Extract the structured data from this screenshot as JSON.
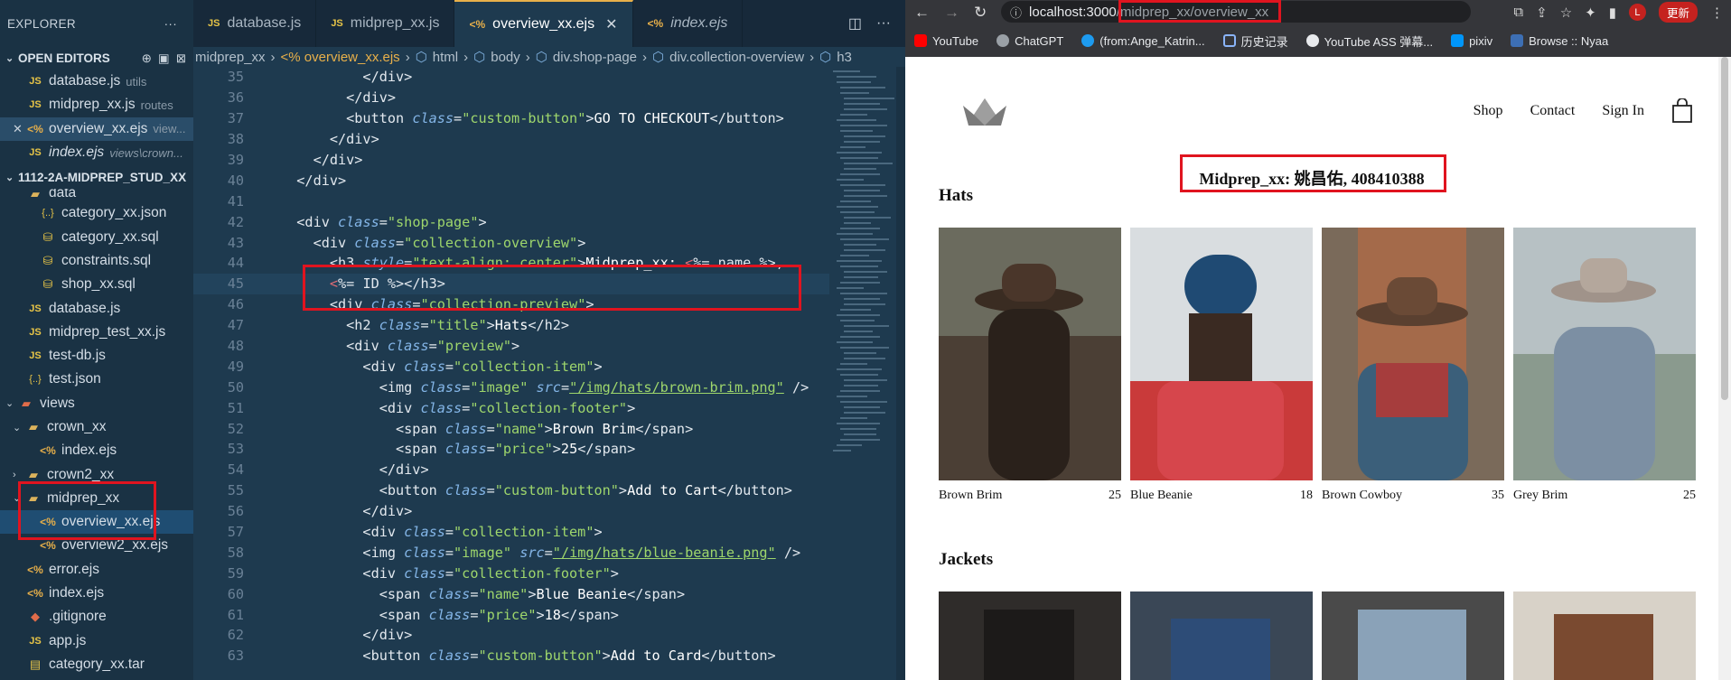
{
  "explorer": {
    "title": "EXPLORER",
    "open_editors_label": "OPEN EDITORS",
    "open_editors": [
      {
        "name": "database.js",
        "dir": "utils"
      },
      {
        "name": "midprep_xx.js",
        "dir": "routes"
      },
      {
        "name": "overview_xx.ejs",
        "dir": "view..."
      },
      {
        "name": "index.ejs",
        "dir": "views\\crown..."
      }
    ],
    "project_label": "1112-2A-MIDPREP_STUD_XX",
    "tree": [
      "data",
      "category_xx.json",
      "category_xx.sql",
      "constraints.sql",
      "shop_xx.sql",
      "database.js",
      "midprep_test_xx.js",
      "test-db.js",
      "test.json",
      "views",
      "crown_xx",
      "index.ejs",
      "crown2_xx",
      "midprep_xx",
      "overview_xx.ejs",
      "overview2_xx.ejs",
      "error.ejs",
      "index.ejs",
      ".gitignore",
      "app.js",
      "category_xx.tar"
    ]
  },
  "tabs": [
    {
      "label": "database.js"
    },
    {
      "label": "midprep_xx.js"
    },
    {
      "label": "overview_xx.ejs"
    },
    {
      "label": "index.ejs"
    }
  ],
  "breadcrumb": [
    "midprep_xx",
    "<% overview_xx.ejs",
    "html",
    "body",
    "div.shop-page",
    "div.collection-overview",
    "h3"
  ],
  "line_numbers": [
    "35",
    "36",
    "37",
    "38",
    "39",
    "40",
    "41",
    "42",
    "43",
    "44",
    "45",
    "",
    "46",
    "47",
    "48",
    "49",
    "50",
    "51",
    "52",
    "53",
    "54",
    "55",
    "56",
    "57",
    "58",
    "59",
    "60",
    "61",
    "62",
    "63"
  ],
  "browser": {
    "url_host": "localhost:3000",
    "url_path": "/midprep_xx/overview_xx",
    "update_label": "更新",
    "avatar_letter": "L",
    "bookmarks": [
      "YouTube",
      "ChatGPT",
      "(from:Ange_Katrin...",
      "历史记录",
      "YouTube ASS 弹幕...",
      "pixiv",
      "Browse :: Nyaa"
    ]
  },
  "site": {
    "nav": [
      "Shop",
      "Contact",
      "Sign In"
    ],
    "heading": "Midprep_xx: 姚昌佑, 408410388",
    "sections": [
      {
        "title": "Hats",
        "items": [
          {
            "name": "Brown Brim",
            "price": "25"
          },
          {
            "name": "Blue Beanie",
            "price": "18"
          },
          {
            "name": "Brown Cowboy",
            "price": "35"
          },
          {
            "name": "Grey Brim",
            "price": "25"
          }
        ]
      },
      {
        "title": "Jackets",
        "items": []
      }
    ]
  },
  "colors": {
    "highlight": "#e0141f",
    "editor_bg": "#1e3a4f",
    "sidebar_bg": "#1a3244"
  }
}
